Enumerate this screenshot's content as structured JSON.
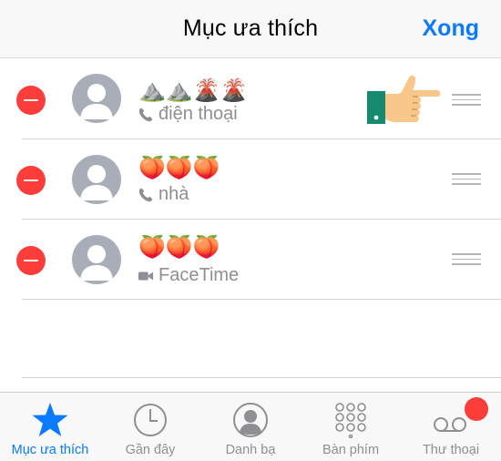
{
  "header": {
    "title": "Mục ưa thích",
    "done_label": "Xong"
  },
  "favorites": [
    {
      "name": "⛰️⛰️🌋🌋",
      "type": "điện thoại",
      "type_icon": "phone-icon"
    },
    {
      "name": "🍑🍑🍑",
      "type": "nhà",
      "type_icon": "phone-icon"
    },
    {
      "name": "🍑🍑🍑",
      "type": "FaceTime",
      "type_icon": "video-camera-icon"
    }
  ],
  "tabbar": {
    "tabs": [
      {
        "label": "Mục ưa thích",
        "icon": "star-icon",
        "active": true
      },
      {
        "label": "Gần đây",
        "icon": "clock-icon",
        "active": false
      },
      {
        "label": "Danh bạ",
        "icon": "contacts-icon",
        "active": false
      },
      {
        "label": "Bàn phím",
        "icon": "keypad-icon",
        "active": false
      },
      {
        "label": "Thư thoại",
        "icon": "voicemail-icon",
        "active": false
      }
    ]
  },
  "colors": {
    "accent": "#0a7aff",
    "delete": "#fc3d39",
    "secondary_text": "#8e8e93"
  }
}
